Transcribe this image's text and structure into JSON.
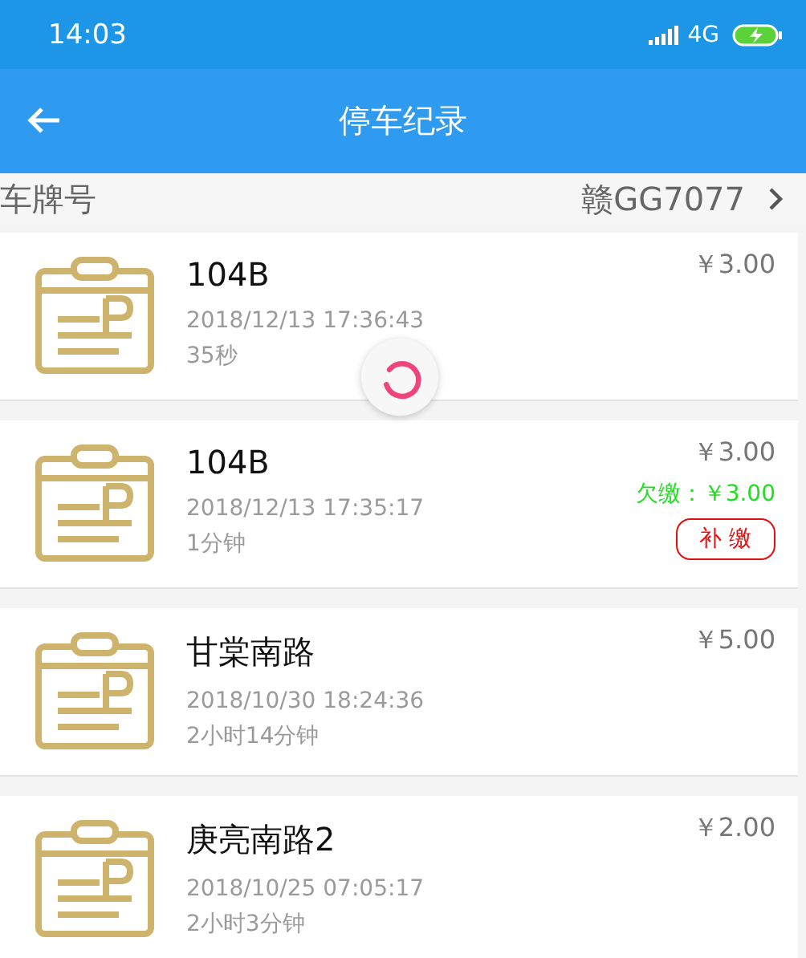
{
  "status_bar": {
    "time": "14:03",
    "network": "4G"
  },
  "header": {
    "title": "停车纪录"
  },
  "plate": {
    "label": "车牌号",
    "value": "赣GG7077"
  },
  "loading": true,
  "records": [
    {
      "name": "104B",
      "time": "2018/12/13 17:36:43",
      "duration": "35秒",
      "price": "￥3.00"
    },
    {
      "name": "104B",
      "time": "2018/12/13 17:35:17",
      "duration": "1分钟",
      "price": "￥3.00",
      "arrears": "欠缴：￥3.00",
      "action": "补 缴"
    },
    {
      "name": "甘棠南路",
      "time": "2018/10/30 18:24:36",
      "duration": "2小时14分钟",
      "price": "￥5.00"
    },
    {
      "name": "庚亮南路2",
      "time": "2018/10/25 07:05:17",
      "duration": "2小时3分钟",
      "price": "￥2.00"
    }
  ]
}
